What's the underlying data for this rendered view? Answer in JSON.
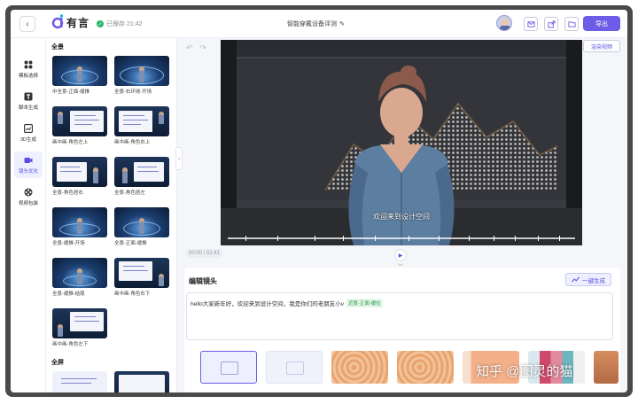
{
  "header": {
    "logo_text": "有言",
    "save_status": "已保存 21:42",
    "doc_title": "智能穿戴设备评测",
    "export_label": "导出"
  },
  "rail": {
    "items": [
      {
        "label": "模板选择",
        "icon": "grid-icon"
      },
      {
        "label": "脚本生成",
        "icon": "text-t-icon"
      },
      {
        "label": "3D生成",
        "icon": "image-icon"
      },
      {
        "label": "镜头优化",
        "icon": "camera-icon",
        "active": true
      },
      {
        "label": "视频包装",
        "icon": "film-reel-icon"
      }
    ]
  },
  "templates": {
    "section_fullshot": "全景",
    "section_fullscreen": "全屏",
    "items": [
      {
        "label": "中全景-正面-缓推"
      },
      {
        "label": "全景-右环绕-开场"
      },
      {
        "label": "画中画-角色左上"
      },
      {
        "label": "画中画-角色右上"
      },
      {
        "label": "全景-角色居右"
      },
      {
        "label": "全景-角色居左"
      },
      {
        "label": "全景-缓推-开场"
      },
      {
        "label": "全景-正面-缓推"
      },
      {
        "label": "全景-缓推-结尾"
      },
      {
        "label": "画中画-角色右下"
      },
      {
        "label": "画中画-角色左下"
      }
    ]
  },
  "canvas": {
    "render_label": "渲染视频",
    "subtitle": "欢迎来到设计空间",
    "time": "00:00 / 01:41"
  },
  "edit": {
    "title": "编辑镜头",
    "generate_label": "一键生成",
    "script_text": "hello大家新年好，欢迎来到设计空间，我是你们的老朋友小v",
    "shot_tag": "近景-正面-缓拉"
  },
  "watermark": "知乎 @图灵的猫",
  "colors": {
    "accent": "#6c5ce7",
    "tag_green": "#2b9a4d"
  }
}
